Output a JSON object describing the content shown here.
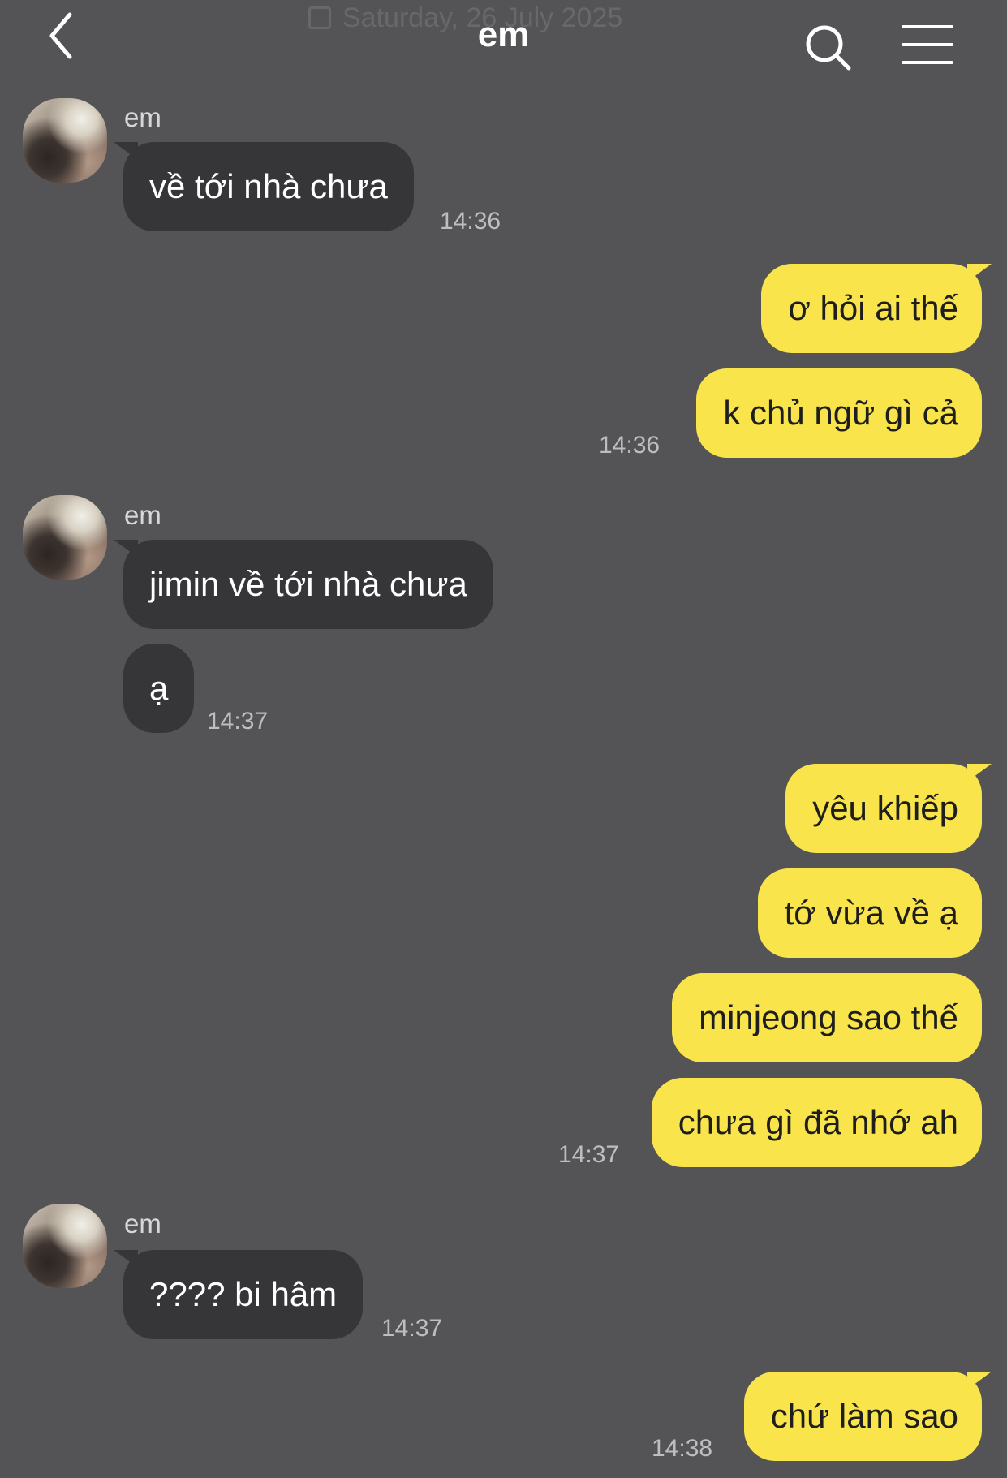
{
  "header": {
    "title": "em",
    "date_label": "Saturday, 26 July 2025"
  },
  "icons": {
    "back": "chevron-left-icon",
    "search": "search-icon",
    "menu": "hamburger-menu-icon",
    "calendar": "calendar-icon"
  },
  "colors": {
    "background": "#545355",
    "incoming_bubble": "#363638",
    "outgoing_bubble": "#f9e54b"
  },
  "messages": [
    {
      "sender": "em",
      "text": "về tới nhà chưa",
      "time": "14:36"
    },
    {
      "text": "ơ hỏi ai thế"
    },
    {
      "text": "k chủ ngữ gì cả",
      "time": "14:36"
    },
    {
      "sender": "em",
      "text": "jimin về tới nhà chưa"
    },
    {
      "text": "ạ",
      "time": "14:37"
    },
    {
      "text": "yêu khiếp"
    },
    {
      "text": "tớ vừa về ạ"
    },
    {
      "text": "minjeong sao thế"
    },
    {
      "text": "chưa gì đã nhớ ah",
      "time": "14:37"
    },
    {
      "sender": "em",
      "text": "???? bi hâm",
      "time": "14:37"
    },
    {
      "text": "chứ làm sao",
      "time": "14:38"
    }
  ]
}
